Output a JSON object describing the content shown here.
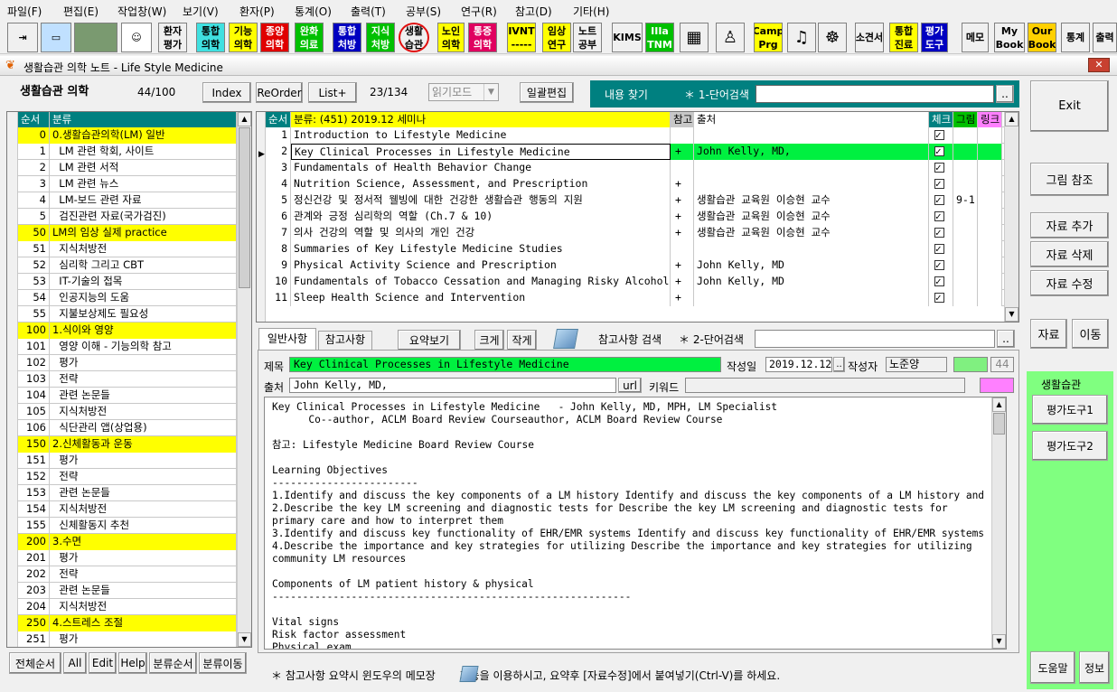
{
  "menu": [
    "파일(F)",
    "편집(E)",
    "작업창(W)",
    "보기(V)",
    "환자(P)",
    "통계(O)",
    "출력(T)",
    "공부(S)",
    "연구(R)",
    "참고(D)",
    "기타(H)"
  ],
  "toolbar": [
    {
      "label": "환자\n평가",
      "bg": "#f0f0f0",
      "fg": "#000"
    },
    {
      "label": "통합\n의학",
      "bg": "#40e0e0",
      "fg": "#000"
    },
    {
      "label": "기능\n의학",
      "bg": "#ffff00",
      "fg": "#000"
    },
    {
      "label": "종양\n의학",
      "bg": "#e00000",
      "fg": "#fff"
    },
    {
      "label": "완화\n의료",
      "bg": "#00c000",
      "fg": "#fff"
    },
    {
      "label": "통합\n처방",
      "bg": "#0000c0",
      "fg": "#fff"
    },
    {
      "label": "지식\n처방",
      "bg": "#00c000",
      "fg": "#fff"
    },
    {
      "label": "생활\n습관",
      "bg": "#f0f0f0",
      "fg": "#000"
    },
    {
      "label": "노인\n의학",
      "bg": "#ffff00",
      "fg": "#000"
    },
    {
      "label": "통증\n의학",
      "bg": "#e00060",
      "fg": "#fff"
    },
    {
      "label": "IVNT\n-----",
      "bg": "#ffff00",
      "fg": "#000"
    },
    {
      "label": "임상\n연구",
      "bg": "#ffff00",
      "fg": "#000"
    },
    {
      "label": "노트\n공부",
      "bg": "#f0f0f0",
      "fg": "#000"
    },
    {
      "label": "KIMS",
      "bg": "#f0f0f0",
      "fg": "#000"
    },
    {
      "label": "IIIa\nTNM",
      "bg": "#00c000",
      "fg": "#fff"
    },
    {
      "label": "Camp\nPrg",
      "bg": "#ffff00",
      "fg": "#000"
    },
    {
      "label": "소견서",
      "bg": "#f0f0f0",
      "fg": "#000"
    },
    {
      "label": "통합\n진료",
      "bg": "#ffff00",
      "fg": "#000"
    },
    {
      "label": "평가\n도구",
      "bg": "#0000c0",
      "fg": "#fff"
    },
    {
      "label": "메모",
      "bg": "#f0f0f0",
      "fg": "#000"
    },
    {
      "label": "My\nBook",
      "bg": "#f0f0f0",
      "fg": "#000"
    },
    {
      "label": "Our\nBook",
      "bg": "#ffd000",
      "fg": "#000"
    },
    {
      "label": "통계",
      "bg": "#f0f0f0",
      "fg": "#000"
    },
    {
      "label": "출력",
      "bg": "#f0f0f0",
      "fg": "#000"
    }
  ],
  "window_title": "생활습관 의학 노트 - Life Style Medicine",
  "topbar": {
    "section_title": "생활습관 의학",
    "count": "44/100",
    "index_btn": "Index",
    "reorder_btn": "ReOrder",
    "listplus_btn": "List+",
    "page_count": "23/134",
    "read_mode": "읽기모드",
    "bulk_edit": "일괄편집",
    "content_search": "내용 찾기",
    "search_hint": "＊ 1-단어검색",
    "search_btn": ".."
  },
  "left_grid": {
    "headers": [
      "순서",
      "분류"
    ],
    "rows": [
      {
        "num": "0",
        "name": "0.생활습관의학(LM) 일반",
        "hl": true
      },
      {
        "num": "1",
        "name": "  LM 관련 학회, 사이트",
        "hl": false
      },
      {
        "num": "2",
        "name": "  LM 관련 서적",
        "hl": false
      },
      {
        "num": "3",
        "name": "  LM 관련 뉴스",
        "hl": false
      },
      {
        "num": "4",
        "name": "  LM-보드 관련 자료",
        "hl": false
      },
      {
        "num": "5",
        "name": "  검진관련 자료(국가검진)",
        "hl": false
      },
      {
        "num": "50",
        "name": "LM의 임상 실제 practice",
        "hl": true
      },
      {
        "num": "51",
        "name": "  지식처방전",
        "hl": false
      },
      {
        "num": "52",
        "name": "  심리학 그리고 CBT",
        "hl": false
      },
      {
        "num": "53",
        "name": "  IT-기술의 접목",
        "hl": false
      },
      {
        "num": "54",
        "name": "  인공지능의 도움",
        "hl": false
      },
      {
        "num": "55",
        "name": "  지불보상제도 필요성",
        "hl": false
      },
      {
        "num": "100",
        "name": "1.식이와 영양",
        "hl": true
      },
      {
        "num": "101",
        "name": "  영양 이해 - 기능의학 참고",
        "hl": false
      },
      {
        "num": "102",
        "name": "  평가",
        "hl": false
      },
      {
        "num": "103",
        "name": "  전략",
        "hl": false
      },
      {
        "num": "104",
        "name": "  관련 논문들",
        "hl": false
      },
      {
        "num": "105",
        "name": "  지식처방전",
        "hl": false
      },
      {
        "num": "106",
        "name": "  식단관리 앱(상업용)",
        "hl": false
      },
      {
        "num": "150",
        "name": "2.신체활동과 운동",
        "hl": true
      },
      {
        "num": "151",
        "name": "  평가",
        "hl": false
      },
      {
        "num": "152",
        "name": "  전략",
        "hl": false
      },
      {
        "num": "153",
        "name": "  관련 논문들",
        "hl": false
      },
      {
        "num": "154",
        "name": "  지식처방전",
        "hl": false
      },
      {
        "num": "155",
        "name": "  신체활동지 추천",
        "hl": false
      },
      {
        "num": "200",
        "name": "3.수면",
        "hl": true
      },
      {
        "num": "201",
        "name": "  평가",
        "hl": false
      },
      {
        "num": "202",
        "name": "  전략",
        "hl": false
      },
      {
        "num": "203",
        "name": "  관련 논문들",
        "hl": false
      },
      {
        "num": "204",
        "name": "  지식처방전",
        "hl": false
      },
      {
        "num": "250",
        "name": "4.스트레스 조절",
        "hl": true
      },
      {
        "num": "251",
        "name": "  평가",
        "hl": false
      }
    ]
  },
  "left_buttons": [
    "전체순서",
    "All",
    "Edit",
    "Help",
    "분류순서",
    "분류이동"
  ],
  "main_grid": {
    "header_num": "순서",
    "header_title": "분류:  (451)    2019.12 세미나",
    "header_ref": "참고",
    "header_source": "출처",
    "header_check": "체크",
    "header_fig": "그림",
    "header_link": "링크",
    "rows": [
      {
        "num": "1",
        "title": "Introduction to Lifestyle Medicine",
        "ref": "",
        "source": "",
        "fig": "",
        "sel": false
      },
      {
        "num": "2",
        "title": "Key Clinical Processes in Lifestyle Medicine",
        "ref": "+",
        "source": "John Kelly, MD,",
        "fig": "",
        "sel": true
      },
      {
        "num": "3",
        "title": "Fundamentals of Health Behavior Change",
        "ref": "",
        "source": "",
        "fig": "",
        "sel": false
      },
      {
        "num": "4",
        "title": "Nutrition Science, Assessment, and Prescription",
        "ref": "+",
        "source": "",
        "fig": "",
        "sel": false
      },
      {
        "num": "5",
        "title": "정신건강 및 정서적 웰빙에 대한 건강한 생활습관 행동의 지원",
        "ref": "+",
        "source": "생활습관 교육원 이승현 교수",
        "fig": "9-1",
        "sel": false
      },
      {
        "num": "6",
        "title": "관계와 긍정 심리학의 역할 (Ch.7 & 10)",
        "ref": "+",
        "source": "생활습관 교육원 이승현 교수",
        "fig": "",
        "sel": false
      },
      {
        "num": "7",
        "title": "의사 건강의 역할 및 의사의 개인 건강",
        "ref": "+",
        "source": "생활습관 교육원 이승현 교수",
        "fig": "",
        "sel": false
      },
      {
        "num": "8",
        "title": "Summaries of Key Lifestyle Medicine Studies",
        "ref": "",
        "source": "",
        "fig": "",
        "sel": false
      },
      {
        "num": "9",
        "title": "Physical Activity Science and Prescription",
        "ref": "+",
        "source": "John Kelly, MD",
        "fig": "",
        "sel": false
      },
      {
        "num": "10",
        "title": "Fundamentals of Tobacco Cessation and Managing Risky Alcohol Use",
        "ref": "+",
        "source": "John Kelly, MD",
        "fig": "",
        "sel": false
      },
      {
        "num": "11",
        "title": "Sleep Health Science and Intervention",
        "ref": "+",
        "source": "",
        "fig": "",
        "sel": false
      }
    ]
  },
  "tabs": {
    "general": "일반사항",
    "reference": "참고사항",
    "summary_btn": "요약보기",
    "bigger": "크게",
    "smaller": "작게",
    "ref_search": "참고사항 검색",
    "search_hint2": "＊ 2-단어검색",
    "search_btn2": ".."
  },
  "detail": {
    "title_label": "제목",
    "title_value": "Key Clinical Processes in Lifestyle Medicine",
    "date_label": "작성일",
    "date_value": "2019.12.12",
    "date_btn": "..",
    "author_label": "작성자",
    "author_value": "노준양",
    "num_value": "44",
    "source_label": "출처",
    "source_value": "John Kelly, MD,",
    "url_btn": "url",
    "keyword_label": "키워드"
  },
  "body_text": "Key Clinical Processes in Lifestyle Medicine   - John Kelly, MD, MPH, LM Specialist\n      Co--author, ACLM Board Review Courseauthor, ACLM Board Review Course\n\n참고: Lifestyle Medicine Board Review Course\n\nLearning Objectives\n------------------------\n1.Identify and discuss the key components of a LM history Identify and discuss the key components of a LM history and physical\n2.Describe the key LM screening and diagnostic tests for Describe the key LM screening and diagnostic tests for\nprimary care and how to interpret them\n3.Identify and discuss key functionality of EHR/EMR systems Identify and discuss key functionality of EHR/EMR systems for LM\n4.Describe the importance and key strategies for utilizing Describe the importance and key strategies for utilizing\ncommunity LM resources\n\nComponents of LM patient history & physical\n-----------------------------------------------------------\n\nVital signs\nRisk factor assessment\nPhysical exam\nLab work and interpretation",
  "right_panel": {
    "exit": "Exit",
    "fig_ref": "그림 참조",
    "add": "자료 추가",
    "delete": "자료 삭제",
    "edit": "자료 수정",
    "data": "자료",
    "move": "이동",
    "section": "생활습관",
    "tool1": "평가도구1",
    "tool2": "평가도구2",
    "help": "도움말",
    "info": "정보"
  },
  "footer": "＊ 참고사항 요약시 윈도우의 메모장       기능을 이용하시고, 요약후 [자료수정]에서 붙여넣기(Ctrl-V)를 하세요."
}
